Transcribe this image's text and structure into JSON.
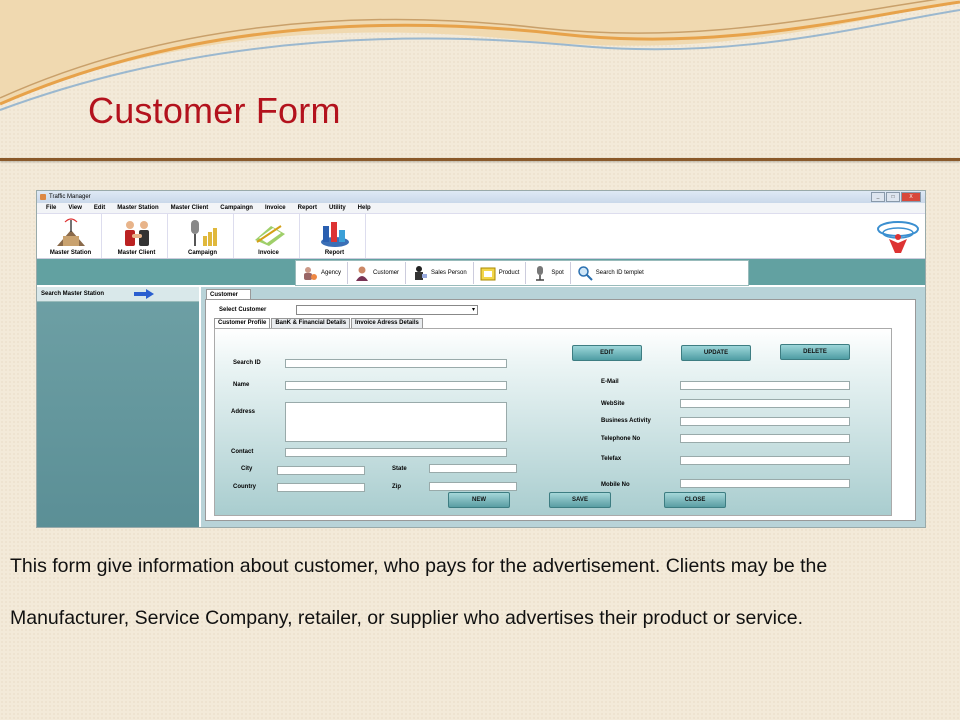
{
  "slide": {
    "title": "Customer Form",
    "caption": "This form give information about customer, who pays for the advertisement.  Clients may be the Manufacturer, Service Company, retailer, or supplier who advertises their product or service."
  },
  "colors": {
    "title": "#b3121d",
    "accent_teal": "#62a1a1",
    "panel_teal": "#5b8f96"
  },
  "window": {
    "title": "Traffic Manager",
    "controls": [
      "_",
      "□",
      "X"
    ],
    "menu": [
      "File",
      "View",
      "Edit",
      "Master Station",
      "Master Client",
      "Campaingn",
      "Invoice",
      "Report",
      "Utility",
      "Help"
    ],
    "toolbar": [
      {
        "label": "Master Station",
        "icon": "radio-tower-icon"
      },
      {
        "label": "Master Client",
        "icon": "handshake-icon"
      },
      {
        "label": "Campaign",
        "icon": "microphone-coins-icon"
      },
      {
        "label": "Invoice",
        "icon": "invoice-icon"
      },
      {
        "label": "Report",
        "icon": "chart-icon"
      }
    ],
    "subnav": [
      {
        "label": "Agency",
        "icon": "agency-icon"
      },
      {
        "label": "Customer",
        "icon": "customer-icon"
      },
      {
        "label": "Sales Person",
        "icon": "sales-person-icon"
      },
      {
        "label": "Product",
        "icon": "product-icon"
      },
      {
        "label": "Spot",
        "icon": "spot-mic-icon"
      },
      {
        "label": "Search ID templet",
        "icon": "search-icon"
      }
    ],
    "left_panel": {
      "label": "Search Master Station",
      "icon": "arrow-right-icon"
    },
    "customer_tab": "Customer",
    "select_customer": {
      "label": "Select Customer",
      "value": ""
    },
    "inner_tabs": [
      "Customer Profile",
      "BanK & Financial Details",
      "Invoice Adress Details"
    ],
    "form": {
      "search_id": "Search ID",
      "name": "Name",
      "address": "Address",
      "contact": "Contact",
      "city": "City",
      "state": "State",
      "country": "Country",
      "zip": "Zip",
      "email": "E-Mail",
      "website": "WebSite",
      "business_activity": "Business Activity",
      "telephone": "Telephone No",
      "telefax": "Telefax",
      "mobile": "Mobile No"
    },
    "buttons": {
      "edit": "EDIT",
      "update": "UPDATE",
      "delete": "DELETE",
      "new": "NEW",
      "save": "SAVE",
      "close": "CLOSE"
    }
  }
}
